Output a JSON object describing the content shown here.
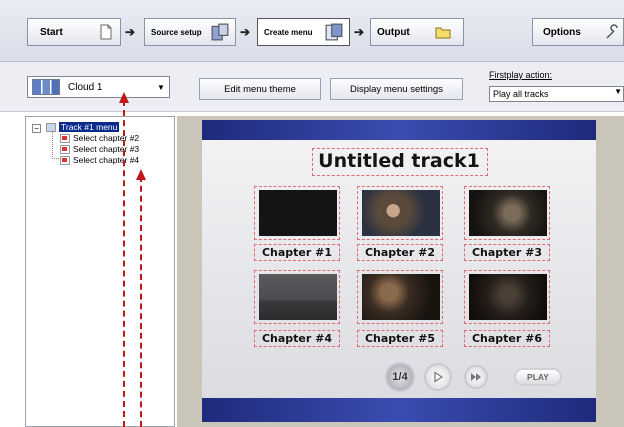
{
  "toolbar": {
    "start": "Start",
    "source_setup": "Source setup",
    "create_menu": "Create menu",
    "output": "Output",
    "options": "Options"
  },
  "theme": {
    "selected": "Cloud 1"
  },
  "buttons": {
    "edit_theme": "Edit menu theme",
    "display_settings": "Display menu settings"
  },
  "firstplay": {
    "label": "Firstplay action:",
    "value": "Play all tracks"
  },
  "tree": {
    "root": "Track #1 menu",
    "items": [
      "Select chapter #2",
      "Select chapter #3",
      "Select chapter #4"
    ]
  },
  "menu": {
    "title": "Untitled track1",
    "chapters": [
      "Chapter #1",
      "Chapter #2",
      "Chapter #3",
      "Chapter #4",
      "Chapter #5",
      "Chapter #6"
    ],
    "page": "1/4",
    "play": "PLAY"
  },
  "colors": {
    "tree_selected_bg": "#0a2a8c",
    "band": "#2a3694",
    "dashed_guides": "#e06b73",
    "annotation": "#c01818"
  }
}
